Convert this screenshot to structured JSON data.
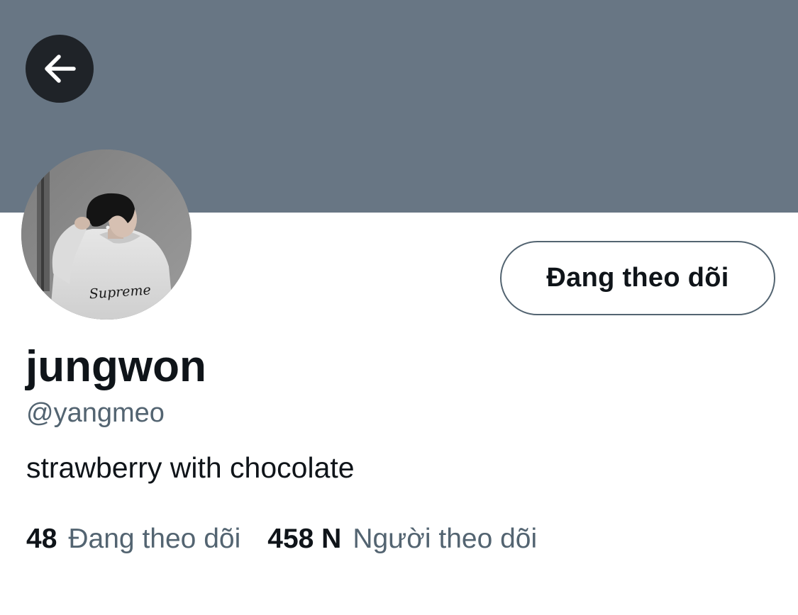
{
  "header": {
    "back_icon": "arrow-left-icon",
    "banner_color": "#687684"
  },
  "profile": {
    "display_name": "jungwon",
    "handle": "@yangmeo",
    "bio": "strawberry with chocolate",
    "avatar_text": "Supreme"
  },
  "actions": {
    "follow_label": "Đang theo dõi"
  },
  "stats": {
    "following_count": "48",
    "following_label": "Đang theo dõi",
    "followers_count": "458 N",
    "followers_label": "Người theo dõi"
  },
  "colors": {
    "primary_text": "#0f1419",
    "secondary_text": "#536471",
    "back_button_bg": "#1f2328"
  }
}
